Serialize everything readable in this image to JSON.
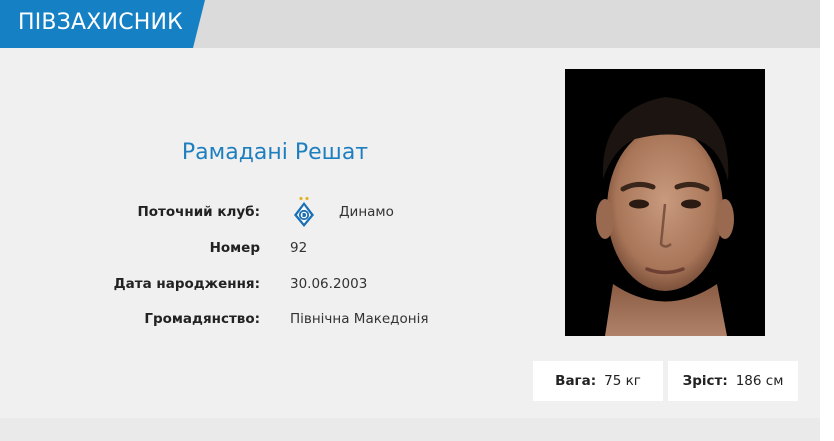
{
  "header": {
    "position_label": "ПІВЗАХИСНИК",
    "accent_color": "#1680c5"
  },
  "player": {
    "name": "Рамадані Решат",
    "name_color": "#1e7fbf",
    "photo_icon": "player-portrait"
  },
  "info": {
    "club": {
      "label": "Поточний клуб:",
      "value": "Динамо",
      "logo_icon": "dynamo-kyiv-logo"
    },
    "number": {
      "label": "Номер",
      "value": "92"
    },
    "birthdate": {
      "label": "Дата народження:",
      "value": "30.06.2003"
    },
    "citizenship": {
      "label": "Громадянство:",
      "value": "Північна Македонія"
    }
  },
  "stats": {
    "weight": {
      "label": "Вага:",
      "value": "75 кг"
    },
    "height": {
      "label": "Зріст:",
      "value": "186 см"
    }
  }
}
